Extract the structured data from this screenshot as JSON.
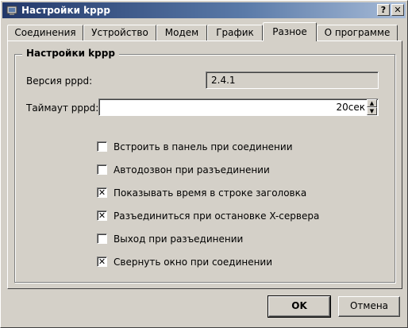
{
  "window": {
    "title": "Настройки kppp",
    "help_label": "?",
    "close_label": "✕"
  },
  "tabs": [
    {
      "label": "Соединения",
      "active": false
    },
    {
      "label": "Устройство",
      "active": false
    },
    {
      "label": "Модем",
      "active": false
    },
    {
      "label": "График",
      "active": false
    },
    {
      "label": "Разное",
      "active": true
    },
    {
      "label": "О программе",
      "active": false
    }
  ],
  "group": {
    "title": "Настройки kppp",
    "version_label": "Версия pppd:",
    "version_value": "2.4.1",
    "timeout_label": "Таймаут pppd:",
    "timeout_value": "20сек",
    "options": [
      {
        "label": "Встроить в панель при соединении",
        "checked": false
      },
      {
        "label": "Автодозвон при разъединении",
        "checked": false
      },
      {
        "label": "Показывать время в строке заголовка",
        "checked": true
      },
      {
        "label": "Разъединиться при остановке X-сервера",
        "checked": true
      },
      {
        "label": "Выход при разъединении",
        "checked": false
      },
      {
        "label": "Свернуть окно при соединении",
        "checked": true
      }
    ]
  },
  "buttons": {
    "ok": "OK",
    "cancel": "Отмена"
  },
  "colors": {
    "title_start": "#22386a",
    "title_end": "#a8bcd8",
    "face": "#d4d0c8"
  },
  "icons": {
    "title": "kppp-app-icon",
    "spin_up": "arrow-up-icon",
    "spin_down": "arrow-down-icon",
    "check": "x-check-mark"
  }
}
